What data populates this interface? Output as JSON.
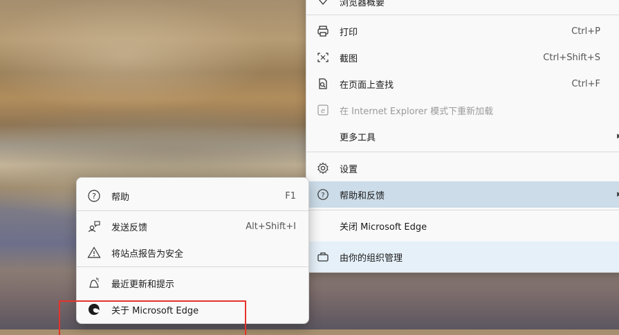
{
  "main_menu": {
    "top_item": "浏览器概要",
    "print": {
      "label": "打印",
      "shortcut": "Ctrl+P"
    },
    "screenshot": {
      "label": "截图",
      "shortcut": "Ctrl+Shift+S"
    },
    "find": {
      "label": "在页面上查找",
      "shortcut": "Ctrl+F"
    },
    "ie_mode": {
      "label": "在 Internet Explorer 模式下重新加载"
    },
    "more_tools": {
      "label": "更多工具"
    },
    "settings": {
      "label": "设置"
    },
    "help_feedback": {
      "label": "帮助和反馈"
    },
    "close_edge": {
      "label": "关闭 Microsoft Edge"
    },
    "managed": {
      "label": "由你的组织管理"
    }
  },
  "sub_menu": {
    "help": {
      "label": "帮助",
      "shortcut": "F1"
    },
    "send_feedback": {
      "label": "发送反馈",
      "shortcut": "Alt+Shift+I"
    },
    "report_safe": {
      "label": "将站点报告为安全"
    },
    "whats_new": {
      "label": "最近更新和提示"
    },
    "about": {
      "label": "关于 Microsoft Edge"
    }
  },
  "colors": {
    "highlight": "#ccdce8",
    "red_box": "#e5332a"
  }
}
